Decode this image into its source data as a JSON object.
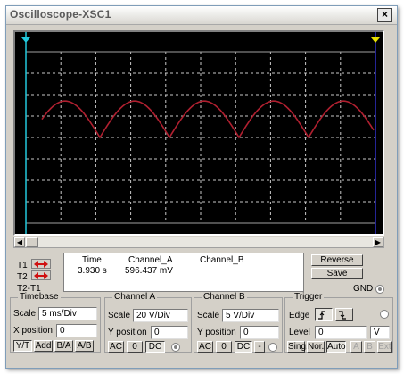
{
  "window": {
    "title": "Oscilloscope-XSC1",
    "close_glyph": "×"
  },
  "colors": {
    "trace": "#b02030",
    "grid": "#c8c8c8",
    "screen_bg": "#000000",
    "cursor_t1": "#22c8dc",
    "cursor_t2": "#e8e000"
  },
  "readout": {
    "t1_label": "T1",
    "t2_label": "T2",
    "diff_label": "T2-T1",
    "col_time": "Time",
    "col_a": "Channel_A",
    "col_b": "Channel_B",
    "t1_time": "3.930 s",
    "t1_a": "596.437 mV"
  },
  "buttons": {
    "reverse": "Reverse",
    "save": "Save",
    "gnd": "GND"
  },
  "timebase": {
    "title": "Timebase",
    "scale_label": "Scale",
    "scale_value": "5 ms/Div",
    "xpos_label": "X position",
    "xpos_value": "0",
    "modes": [
      "Y/T",
      "Add",
      "B/A",
      "A/B"
    ]
  },
  "channel_a": {
    "title": "Channel A",
    "scale_label": "Scale",
    "scale_value": "20  V/Div",
    "ypos_label": "Y position",
    "ypos_value": "0",
    "coupling": [
      "AC",
      "0",
      "DC"
    ]
  },
  "channel_b": {
    "title": "Channel B",
    "scale_label": "Scale",
    "scale_value": "5  V/Div",
    "ypos_label": "Y position",
    "ypos_value": "0",
    "coupling": [
      "AC",
      "0",
      "DC",
      "-"
    ]
  },
  "trigger": {
    "title": "Trigger",
    "edge_label": "Edge",
    "level_label": "Level",
    "level_value": "0",
    "level_unit": "V",
    "modes": [
      "Sing.",
      "Nor.",
      "Auto"
    ],
    "sources": [
      "A",
      "B",
      "Ext"
    ]
  },
  "trace": {
    "description": "full-wave rectified sine",
    "peaks": 5,
    "peak_divisions": 1.7,
    "baseline_divisions": 0
  }
}
